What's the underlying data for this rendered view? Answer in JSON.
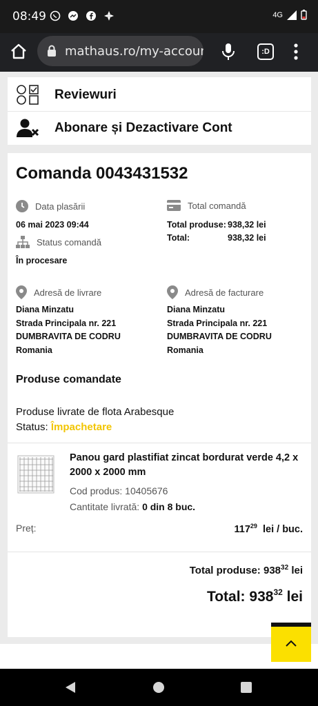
{
  "status_bar": {
    "time": "08:49",
    "network": "4G"
  },
  "browser": {
    "url": "mathaus.ro/my-account",
    "tab_count": ":D"
  },
  "account_menu": [
    {
      "label": "Reviewuri",
      "icon": "reviews-icon"
    },
    {
      "label": "Abonare și Dezactivare Cont",
      "icon": "user-remove-icon"
    }
  ],
  "order": {
    "title": "Comanda 0043431532",
    "date_label": "Data plasării",
    "date_value": "06 mai 2023 09:44",
    "status_label": "Status comandă",
    "status_value": "În procesare",
    "total_label": "Total comandă",
    "total_products_label": "Total produse:",
    "total_products_value": "938,32 lei",
    "total_label_short": "Total:",
    "total_value": "938,32 lei",
    "delivery": {
      "label": "Adresă de livrare",
      "name": "Diana Minzatu",
      "street": "Strada Principala nr. 221",
      "city": "DUMBRAVITA DE CODRU",
      "country": "Romania"
    },
    "billing": {
      "label": "Adresă de facturare",
      "name": "Diana Minzatu",
      "street": "Strada Principala nr. 221",
      "city": "DUMBRAVITA DE CODRU",
      "country": "Romania"
    },
    "products_heading": "Produse comandate",
    "fleet": "Produse livrate de flota Arabesque",
    "fleet_status_label": "Status:",
    "fleet_status_value": "Împachetare",
    "fleet_status_color": "#f2c500",
    "product": {
      "name": "Panou gard plastifiat zincat bordurat verde 4,2 x 2000 x 2000 mm",
      "code_label": "Cod produs:",
      "code_value": "10405676",
      "qty_label": "Cantitate livrată:",
      "qty_value": "0 din 8 buc.",
      "price_label": "Preț:",
      "price_int": "117",
      "price_dec": "29",
      "price_unit": "lei / buc."
    },
    "summary": {
      "products_label": "Total produse:",
      "products_int": "938",
      "products_dec": "32",
      "currency": "lei",
      "total_label": "Total:",
      "total_int": "938",
      "total_dec": "32"
    }
  },
  "colors": {
    "accent": "#fbe000",
    "dark": "#111111"
  }
}
